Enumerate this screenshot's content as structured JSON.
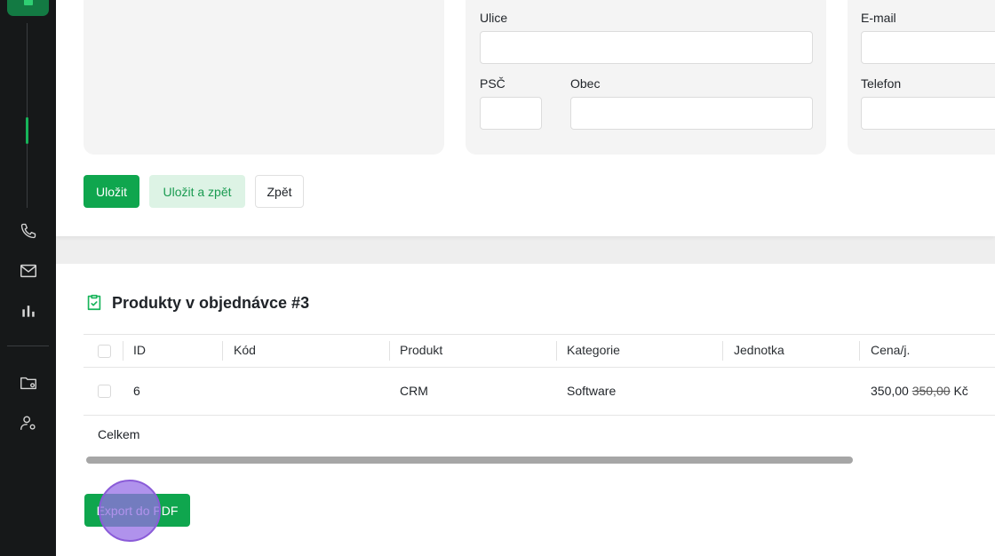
{
  "form": {
    "street_label": "Ulice",
    "zip_label": "PSČ",
    "city_label": "Obec",
    "email_label": "E-mail",
    "phone_label": "Telefon",
    "street_value": "",
    "zip_value": "",
    "city_value": "",
    "email_value": "",
    "phone_value": ""
  },
  "buttons": {
    "save": "Uložit",
    "save_back": "Uložit a zpět",
    "back": "Zpět",
    "export": "Export do PDF"
  },
  "products": {
    "title": "Produkty v objednávce #3",
    "columns": [
      "ID",
      "Kód",
      "Produkt",
      "Kategorie",
      "Jednotka",
      "Cena/j."
    ],
    "rows": [
      {
        "id": "6",
        "code": "",
        "product": "CRM",
        "category": "Software",
        "unit": "",
        "price": "350,00",
        "old_price": "350,00",
        "currency": "Kč"
      }
    ],
    "total_label": "Celkem"
  },
  "sidebar": {
    "icons": [
      "phone-icon",
      "mail-icon",
      "chart-icon",
      "folder-settings-icon",
      "user-settings-icon"
    ]
  },
  "colors": {
    "accent": "#0fa64e",
    "sidebar_bg": "#161819",
    "cursor": "#966ee6"
  }
}
